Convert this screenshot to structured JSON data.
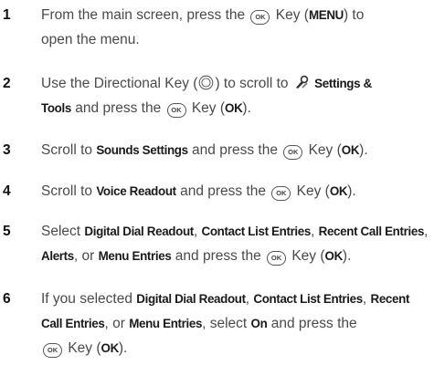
{
  "steps": [
    {
      "num": "1",
      "line1_a": "From the main screen, press the",
      "key_label": "OK",
      "line1_b": "Key (",
      "bold1": "MENU",
      "line1_c": ") to",
      "line2": "open the menu."
    },
    {
      "num": "2",
      "line1_a": "Use the Directional Key (",
      "line1_b": ") to scroll to",
      "bold1": "Settings &",
      "bold2": "Tools",
      "line2_a": "and press the",
      "key_label": "OK",
      "line2_b": "Key (",
      "bold3": "OK",
      "line2_c": ")."
    },
    {
      "num": "3",
      "line1_a": "Scroll to",
      "bold1": "Sounds Settings",
      "line1_b": "and press the",
      "key_label": "OK",
      "line1_c": "Key (",
      "bold2": "OK",
      "line1_d": ")."
    },
    {
      "num": "4",
      "line1_a": "Scroll to",
      "bold1": "Voice Readout",
      "line1_b": "and press the",
      "key_label": "OK",
      "line1_c": "Key (",
      "bold2": "OK",
      "line1_d": ")."
    },
    {
      "num": "5",
      "line1_a": "Select",
      "bold1": "Digital Dial Readout",
      "sep1": ",",
      "bold2": "Contact List Entries",
      "sep2": ",",
      "bold3": "Recent Call Entries",
      "sep3": ",",
      "bold4": "Alerts",
      "line2_a": ", or",
      "bold5": "Menu Entries",
      "line2_b": "and press the",
      "key_label": "OK",
      "line2_c": "Key (",
      "bold6": "OK",
      "line2_d": ")."
    },
    {
      "num": "6",
      "line1_a": "If you selected",
      "bold1": "Digital Dial Readout",
      "sep1": ",",
      "bold2": "Contact List Entries",
      "sep2": ",",
      "bold3": "Recent",
      "bold4": "Call Entries",
      "line2_a": ", or",
      "bold5": "Menu Entries",
      "line2_b": ", select",
      "bold6": "On",
      "line2_c": "and press the",
      "key_label": "OK",
      "line3_a": "Key (",
      "bold7": "OK",
      "line3_b": ")."
    }
  ]
}
